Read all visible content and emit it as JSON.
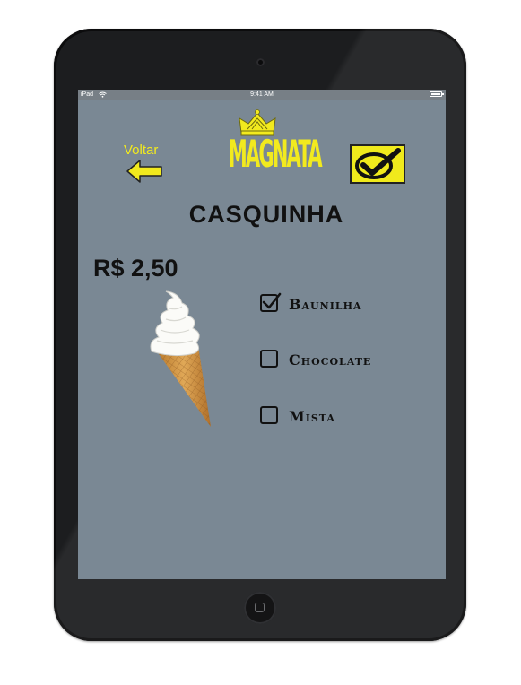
{
  "status_bar": {
    "carrier": "iPad",
    "time": "9:41 AM"
  },
  "header": {
    "back_label": "Voltar",
    "logo_text": "MAGNATA"
  },
  "product": {
    "title": "CASQUINHA",
    "price": "R$ 2,50"
  },
  "flavors": [
    {
      "label": "Baunilha",
      "checked": true
    },
    {
      "label": "Chocolate",
      "checked": false
    },
    {
      "label": "Mista",
      "checked": false
    }
  ],
  "colors": {
    "screen_background": "#7a8894",
    "accent_yellow": "#f2ea1e",
    "tablet_body": "#1c1d1f"
  },
  "icons": [
    "back-arrow-icon",
    "crown-icon",
    "checkmark-icon",
    "ice-cream-cone-icon"
  ]
}
